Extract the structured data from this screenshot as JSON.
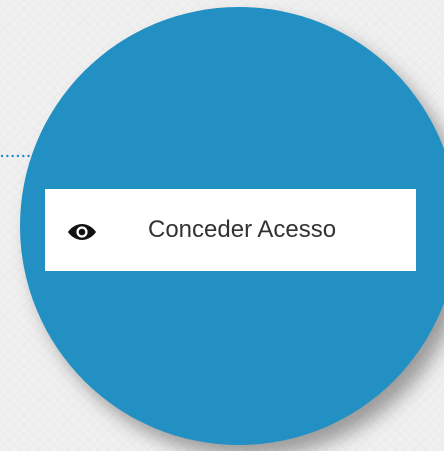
{
  "menu": {
    "item_label": "Conceder Acesso",
    "icon": "eye-icon"
  },
  "colors": {
    "circle": "#2390c4",
    "connector": "#2390c4",
    "item_background": "#ffffff",
    "label": "#333333",
    "icon": "#111111"
  }
}
